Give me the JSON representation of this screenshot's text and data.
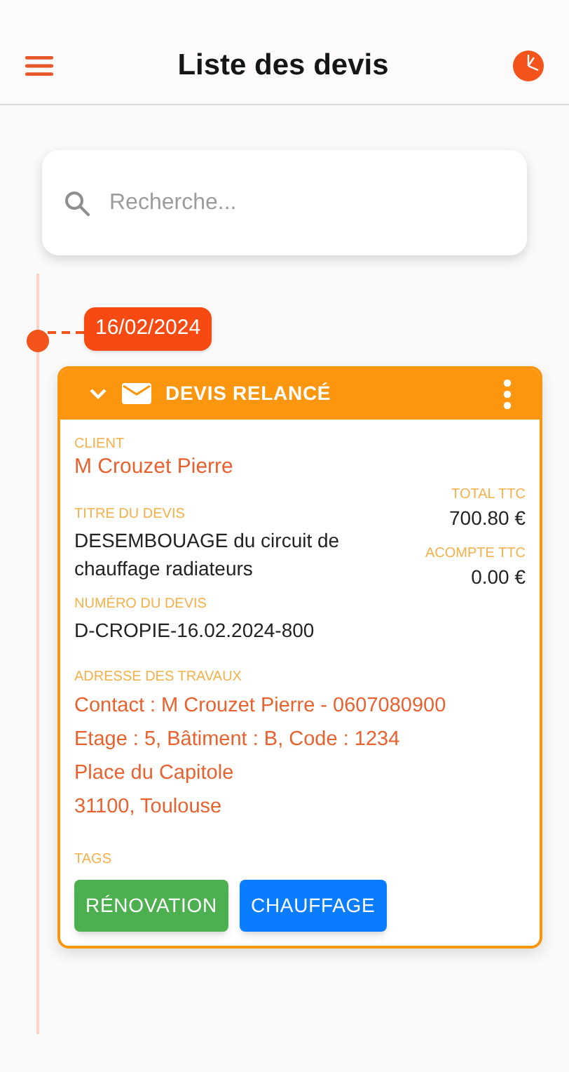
{
  "header": {
    "title": "Liste des devis"
  },
  "search": {
    "placeholder": "Recherche..."
  },
  "entries": [
    {
      "date": "16/02/2024",
      "status": "DEVIS RELANCÉ",
      "expanded": true,
      "client_label": "CLIENT",
      "client": "M Crouzet Pierre",
      "title_label": "TITRE DU DEVIS",
      "title": "DESEMBOUAGE du circuit de chauffage radiateurs",
      "total_label": "TOTAL TTC",
      "total": "700.80 €",
      "deposit_label": "ACOMPTE TTC",
      "deposit": "0.00 €",
      "number_label": "NUMÉRO DU DEVIS",
      "number": "D-CROPIE-16.02.2024-800",
      "address_label": "ADRESSE DES TRAVAUX",
      "address_lines": [
        "Contact : M Crouzet Pierre - 0607080900",
        "Etage : 5, Bâtiment : B, Code : 1234",
        "Place du Capitole",
        "31100, Toulouse"
      ],
      "tags_label": "TAGS",
      "tags": [
        {
          "label": "RÉNOVATION",
          "color": "#4caf50"
        },
        {
          "label": "CHAUFFAGE",
          "color": "#0a7cff"
        }
      ]
    }
  ]
}
